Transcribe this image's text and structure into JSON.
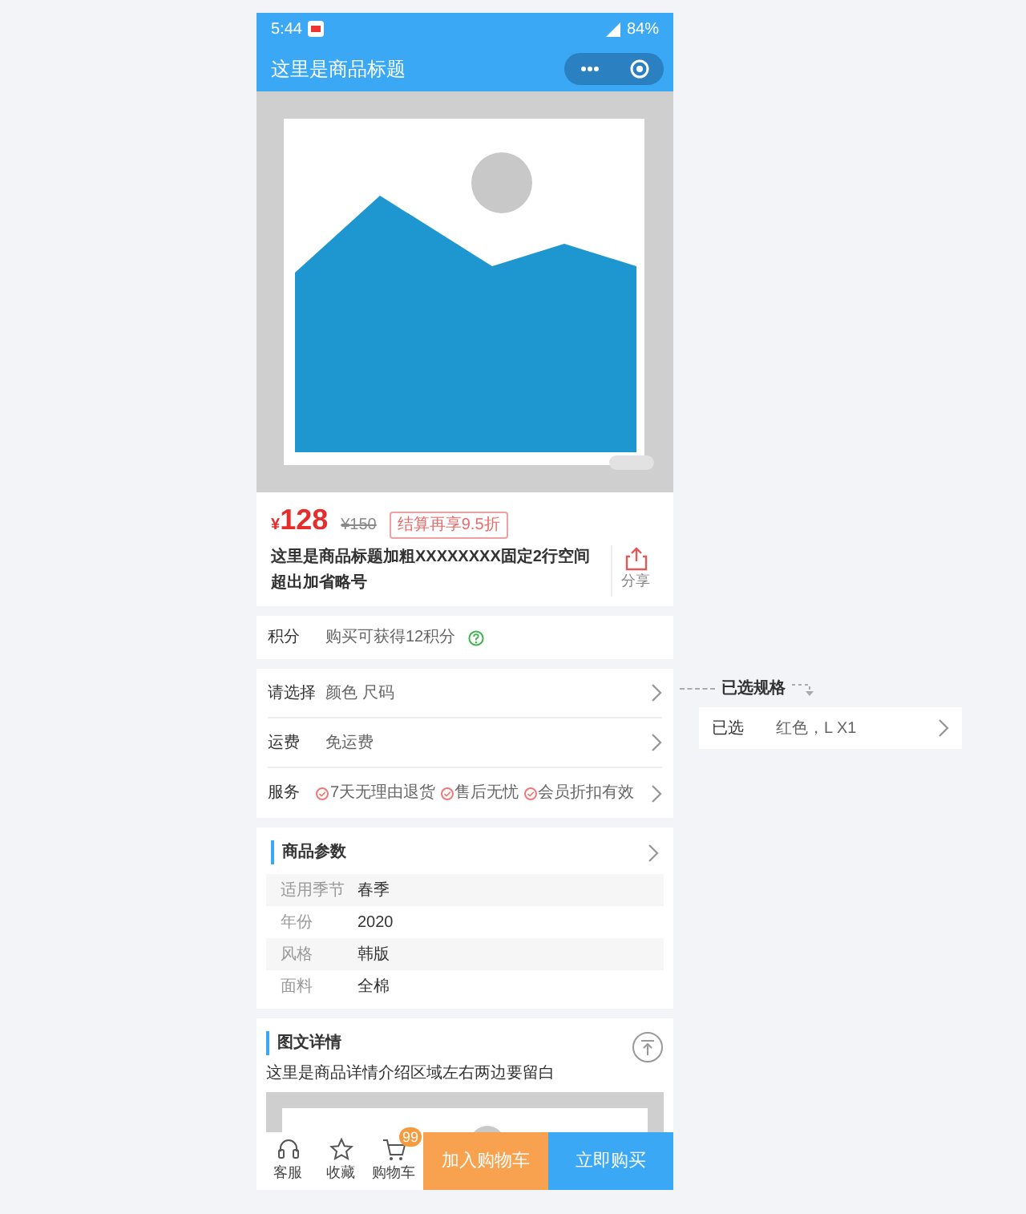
{
  "status_bar": {
    "time": "5:44",
    "battery": "84%"
  },
  "nav_bar": {
    "title": "这里是商品标题"
  },
  "price": {
    "currency": "¥",
    "amount": "128",
    "original": "¥150",
    "promo": "结算再享9.5折"
  },
  "product": {
    "title": "这里是商品标题加粗XXXXXXXX固定2行空间超出加省略号",
    "share": "分享"
  },
  "points": {
    "label": "积分",
    "text": "购买可获得12积分"
  },
  "options": [
    {
      "label": "请选择",
      "value": "颜色 尺码"
    },
    {
      "label": "运费",
      "value": "免运费"
    }
  ],
  "services": {
    "label": "服务",
    "items": [
      "7天无理由退货",
      "售后无忧",
      "会员折扣有效"
    ]
  },
  "params": {
    "title": "商品参数",
    "rows": [
      {
        "name": "适用季节",
        "value": "春季"
      },
      {
        "name": "年份",
        "value": "2020"
      },
      {
        "name": "风格",
        "value": "韩版"
      },
      {
        "name": "面料",
        "value": "全棉"
      }
    ]
  },
  "detail": {
    "title": "图文详情",
    "text": "这里是商品详情介绍区域左右两边要留白"
  },
  "bottom_bar": {
    "actions": [
      {
        "kind": "service",
        "label": "客服"
      },
      {
        "kind": "favorite",
        "label": "收藏"
      },
      {
        "kind": "cart",
        "label": "购物车",
        "badge": "99"
      }
    ],
    "add_to_cart": "加入购物车",
    "buy_now": "立即购买"
  },
  "annotation": {
    "title": "已选规格",
    "label": "已选",
    "value": "红色，L X1"
  }
}
